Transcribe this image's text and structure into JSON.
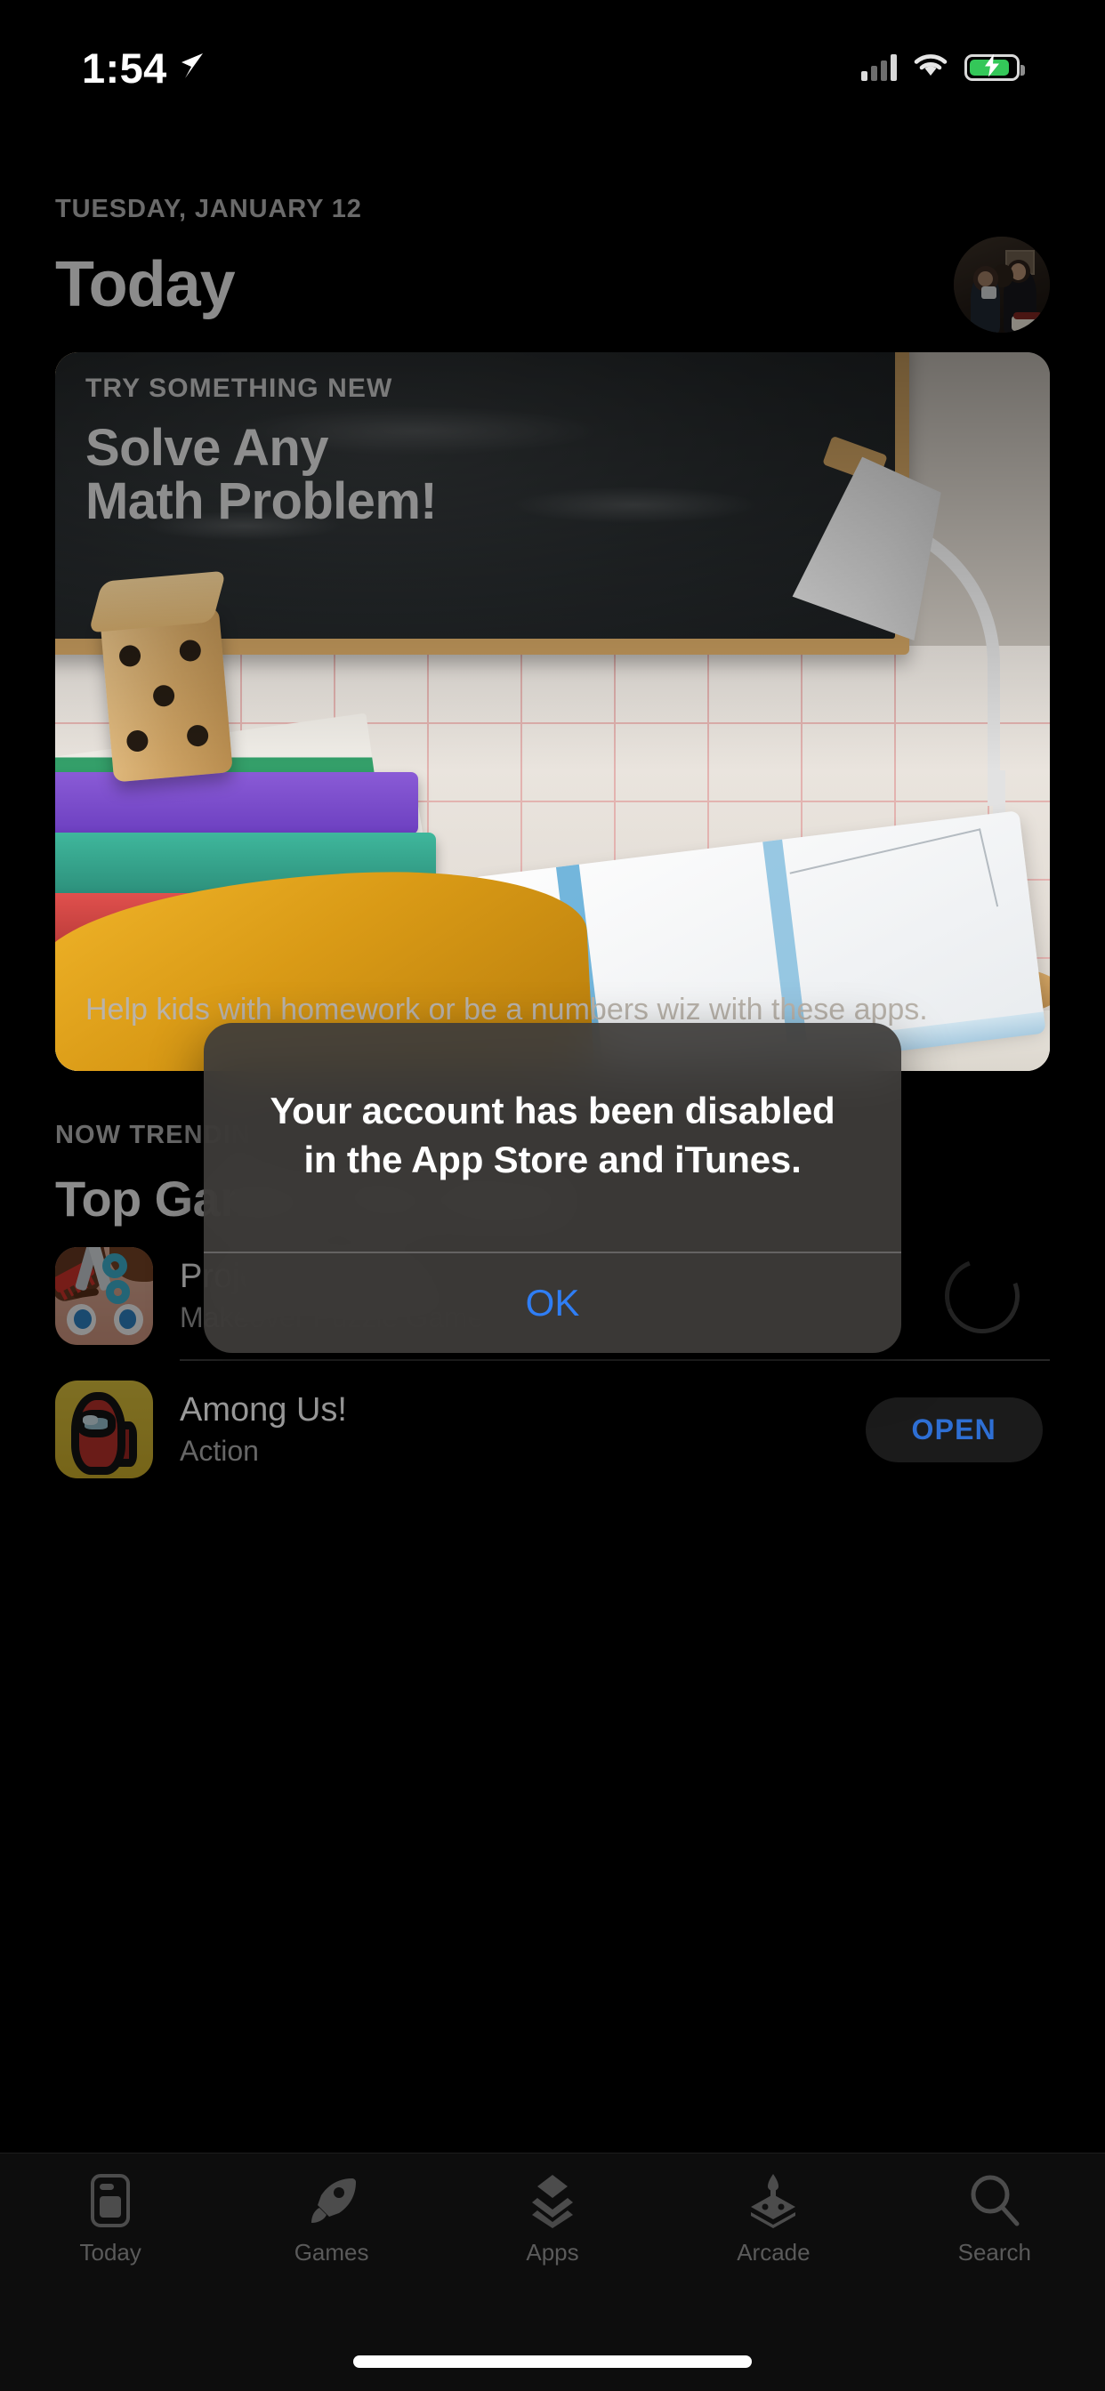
{
  "status_bar": {
    "time": "1:54",
    "location_icon": "location-arrow-icon",
    "cellular_icon": "cellular-bars-icon",
    "wifi_icon": "wifi-icon",
    "battery_icon": "battery-charging-icon",
    "battery_color": "#34c759"
  },
  "header": {
    "date": "TUESDAY, JANUARY 12",
    "title": "Today",
    "avatar": "account-avatar"
  },
  "feature_card": {
    "eyebrow": "TRY SOMETHING NEW",
    "headline_line1": "Solve Any",
    "headline_line2": "Math Problem!",
    "caption": "Help kids with homework or be a numbers wiz with these apps."
  },
  "trending": {
    "eyebrow": "NOW TRENDING",
    "title": "Top Games This Week",
    "apps": [
      {
        "name": "Project Makeover",
        "subtitle": "Makeover Puzzle Game",
        "action": "loading-spinner",
        "action_label": ""
      },
      {
        "name": "Among Us!",
        "subtitle": "Action",
        "action": "open-button",
        "action_label": "OPEN"
      }
    ]
  },
  "alert": {
    "message": "Your account has been disabled in the App Store and iTunes.",
    "ok_label": "OK",
    "ok_color": "#2f7ef5"
  },
  "tabbar": {
    "items": [
      {
        "label": "Today",
        "icon": "today-card-icon"
      },
      {
        "label": "Games",
        "icon": "rocket-icon"
      },
      {
        "label": "Apps",
        "icon": "stacked-diamonds-icon"
      },
      {
        "label": "Arcade",
        "icon": "arcade-joystick-icon"
      },
      {
        "label": "Search",
        "icon": "magnifier-icon"
      }
    ]
  },
  "home_indicator": "home-indicator"
}
